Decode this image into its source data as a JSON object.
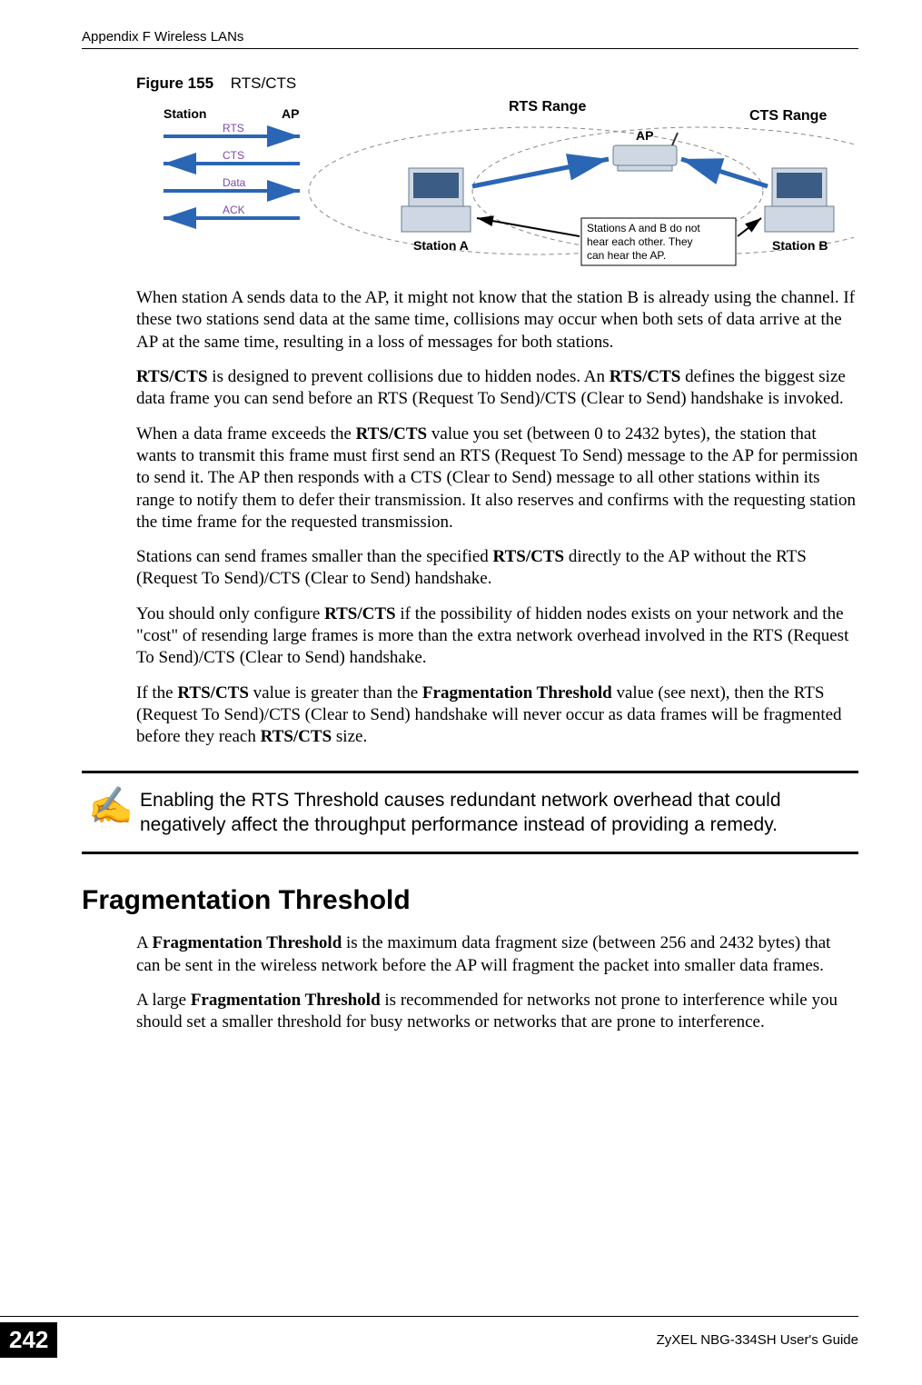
{
  "header": {
    "left": "Appendix F Wireless LANs"
  },
  "figure": {
    "label": "Figure 155",
    "title": "RTS/CTS",
    "seq": {
      "station": "Station",
      "ap": "AP",
      "rts": "RTS",
      "cts": "CTS",
      "data": "Data",
      "ack": "ACK"
    },
    "range": {
      "rts_range": "RTS Range",
      "cts_range": "CTS Range",
      "ap": "AP",
      "station_a": "Station  A",
      "station_b": "Station B",
      "note1": "Stations A and B do not",
      "note2": "hear each other. They",
      "note3": "can hear the AP."
    }
  },
  "paragraphs": {
    "p1": "When station A sends data to the AP, it might not know that the station B is already using the channel. If these two stations send data at the same time, collisions may occur when both sets of data arrive at the AP at the same time, resulting in a loss of messages for both stations.",
    "p2a": "RTS/CTS",
    "p2b": " is designed to prevent collisions due to hidden nodes. An ",
    "p2c": "RTS/CTS",
    "p2d": " defines the biggest size data frame you can send before an RTS (Request To Send)/CTS (Clear to Send) handshake is invoked.",
    "p3a": "When a data frame exceeds the ",
    "p3b": "RTS/CTS",
    "p3c": " value you set (between 0 to 2432 bytes), the station that wants to transmit this frame must first send an RTS (Request To Send) message to the AP for permission to send it. The AP then responds with a CTS (Clear to Send) message to all other stations within its range to notify them to defer their transmission. It also reserves and confirms with the requesting station the time frame for the requested transmission.",
    "p4a": "Stations can send frames smaller than the specified ",
    "p4b": "RTS/CTS",
    "p4c": " directly to the AP without the RTS (Request To Send)/CTS (Clear to Send) handshake.",
    "p5a": "You should only configure ",
    "p5b": "RTS/CTS",
    "p5c": " if the possibility of hidden nodes exists on your network and the \"cost\" of resending large frames is more than the extra network overhead involved in the RTS (Request To Send)/CTS (Clear to Send) handshake.",
    "p6a": "If the ",
    "p6b": "RTS/CTS",
    "p6c": " value is greater than the ",
    "p6d": "Fragmentation Threshold",
    "p6e": " value (see next), then the RTS (Request To Send)/CTS (Clear to Send) handshake will never occur as data frames will be fragmented before they reach ",
    "p6f": "RTS/CTS",
    "p6g": " size."
  },
  "note": {
    "text": "Enabling the RTS Threshold causes redundant network overhead that could negatively affect the throughput performance instead of providing a remedy."
  },
  "section": {
    "title": "Fragmentation Threshold"
  },
  "frag": {
    "p1a": "A ",
    "p1b": "Fragmentation Threshold",
    "p1c": " is the maximum data fragment size (between 256 and 2432 bytes) that can be sent in the wireless network before the AP will fragment the packet into smaller data frames.",
    "p2a": "A large ",
    "p2b": "Fragmentation Threshold",
    "p2c": " is recommended for networks not prone to interference while you should set a smaller threshold for busy networks or networks that are prone to interference."
  },
  "footer": {
    "page": "242",
    "guide": "ZyXEL NBG-334SH User's Guide"
  }
}
